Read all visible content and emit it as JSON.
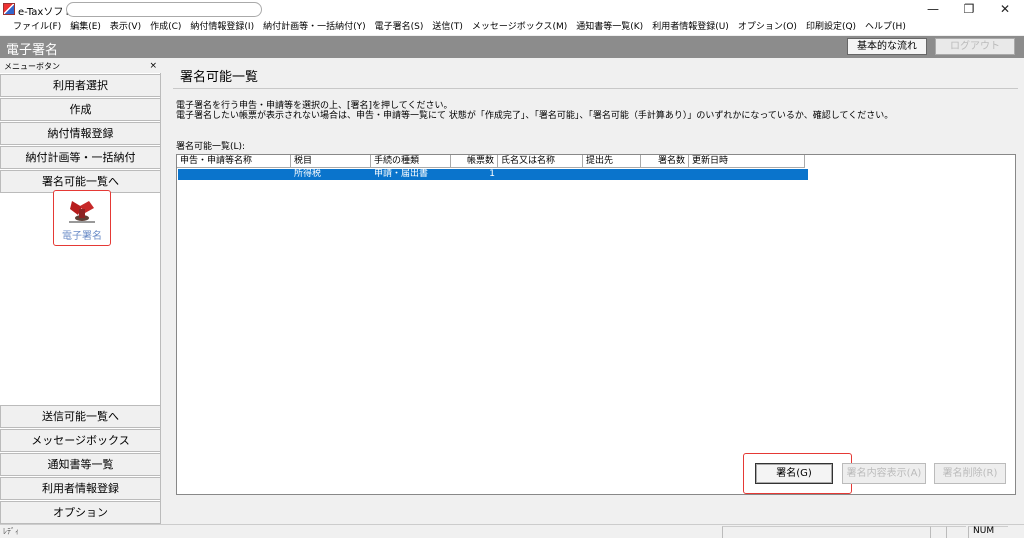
{
  "app": {
    "title": "e-Taxソフト"
  },
  "window_controls": {
    "minimize": "—",
    "restore": "❐",
    "close": "✕"
  },
  "menu": [
    "ファイル(F)",
    "編集(E)",
    "表示(V)",
    "作成(C)",
    "納付情報登録(I)",
    "納付計画等・一括納付(Y)",
    "電子署名(S)",
    "送信(T)",
    "メッセージボックス(M)",
    "通知書等一覧(K)",
    "利用者情報登録(U)",
    "オプション(O)",
    "印刷設定(Q)",
    "ヘルプ(H)"
  ],
  "system_bar": {
    "title": "電子署名",
    "flow_button": "基本的な流れ",
    "logout_button": "ログアウト"
  },
  "sidebar": {
    "header": "メニューボタン",
    "close_glyph": "×",
    "top_items": [
      "利用者選択",
      "作成",
      "納付情報登録",
      "納付計画等・一括納付",
      "署名可能一覧へ"
    ],
    "active_icon_label": "電子署名",
    "bottom_items": [
      "送信可能一覧へ",
      "メッセージボックス",
      "通知書等一覧",
      "利用者情報登録",
      "オプション"
    ]
  },
  "main": {
    "title": "署名可能一覧",
    "description_line1": "電子署名を行う申告・申請等を選択の上、[署名]を押してください。",
    "description_line2": "電子署名したい帳票が表示されない場合は、申告・申請等一覧にて 状態が「作成完了」、「署名可能」、「署名可能（手計算あり）」のいずれかになっているか、確認してください。",
    "list_label": "署名可能一覧(L):",
    "columns": [
      "申告・申請等名称",
      "税目",
      "手続の種類",
      "帳票数",
      "氏名又は名称",
      "提出先",
      "署名数",
      "更新日時"
    ],
    "rows": [
      {
        "name": "",
        "tax": "所得税",
        "procedure": "申請・届出書",
        "forms": "1",
        "person": "",
        "destination": "",
        "signatures": "",
        "updated": ""
      }
    ]
  },
  "actions": {
    "sign": "署名(G)",
    "view_signature": "署名内容表示(A)",
    "remove_signature": "署名削除(R)"
  },
  "status": {
    "text": "ﾚﾃﾞｨ",
    "num": "NUM"
  },
  "colors": {
    "selection": "#0a74cc",
    "highlight_box": "#e53935",
    "system_bar": "#8c8c8c"
  }
}
